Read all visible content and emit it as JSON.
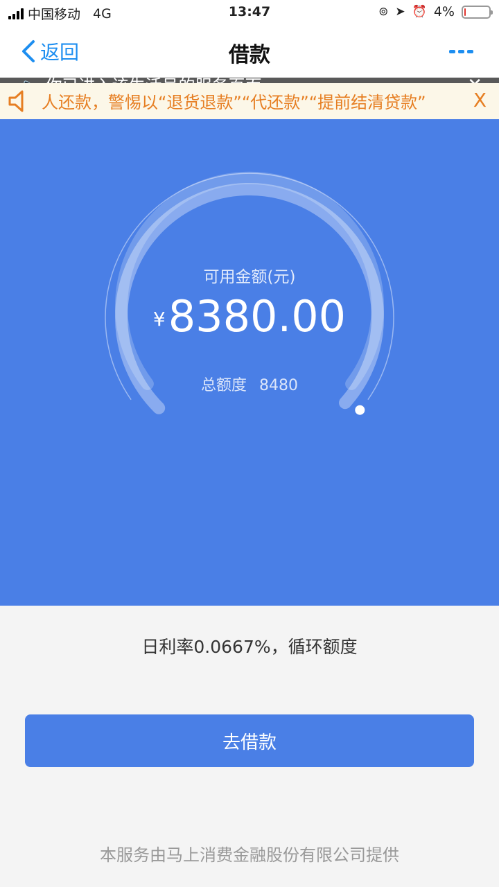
{
  "status_bar": {
    "carrier": "中国移动",
    "network": "4G",
    "time": "13:47",
    "battery": "4%",
    "battery_level": 0.04
  },
  "nav": {
    "back_label": "返回",
    "title": "借款"
  },
  "notice_overlay": {
    "text": "你已进入该生活号的服务页面"
  },
  "ticker": {
    "text": "人还款，警惕以“退货退款”“代还款”“提前结清贷款”"
  },
  "gauge": {
    "label": "可用金额(元)",
    "currency": "¥",
    "amount": "8380.00",
    "total_label": "总额度",
    "total_value": "8480",
    "fill_ratio": 0.988
  },
  "info": {
    "rate_text": "日利率0.0667%，循环额度"
  },
  "action": {
    "borrow_label": "去借款"
  },
  "footer": {
    "text": "本服务由马上消费金融股份有限公司提供"
  },
  "colors": {
    "brand_blue": "#4a7fe6",
    "link_blue": "#1d8ef0",
    "ticker_orange": "#e67e22",
    "ticker_bg": "#fcf7e8"
  }
}
